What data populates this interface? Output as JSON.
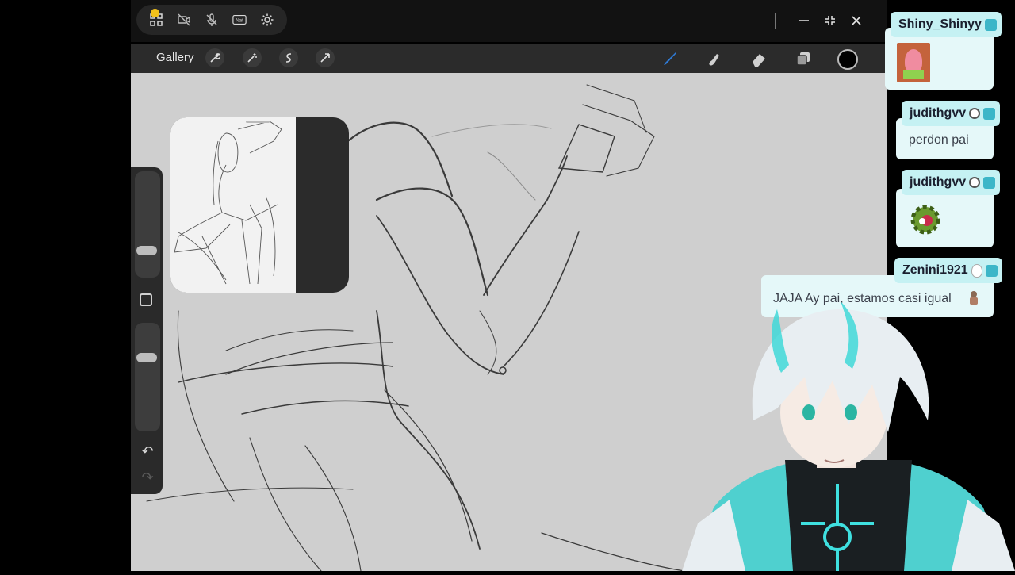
{
  "system_bar": {
    "icons": [
      "grid-icon",
      "camera-off-icon",
      "mic-off-icon",
      "nat-icon",
      "gear-icon"
    ],
    "nat_label": "Nat",
    "window_controls": [
      "minimize-icon",
      "collapse-icon",
      "close-icon"
    ],
    "recording_dot_color": "#f4c21b"
  },
  "toolbar": {
    "gallery_label": "Gallery",
    "left_tools": [
      "wrench-icon",
      "magic-wand-icon",
      "selection-icon",
      "transform-arrow-icon"
    ],
    "right_tools": [
      "brush-icon",
      "smudge-icon",
      "eraser-icon",
      "layers-icon"
    ],
    "active_tool": "brush-icon",
    "accent_color": "#2f7bd6",
    "current_color": "#000000"
  },
  "sidebar": {
    "size_slider_level": 0.25,
    "opacity_slider_level": 0.75,
    "controls": [
      "modify-square-icon",
      "undo-icon",
      "redo-icon"
    ]
  },
  "reference_window": {
    "content": "reference-sketch-image"
  },
  "chat": {
    "bubble_color": "#e5f8f9",
    "name_color": "#c5f1f3",
    "messages": [
      {
        "user": "Shiny_Shinyy",
        "text": "",
        "emote": "patrick-emote-icon"
      },
      {
        "user": "judithgvv",
        "text": "perdon pai",
        "emote": ""
      },
      {
        "user": "judithgvv",
        "text": "",
        "emote": "gear-emote-icon"
      },
      {
        "user": "Zenini1921",
        "text": "JAJA Ay pai, estamos casi igual",
        "emote": "small-figure-emote-icon"
      }
    ]
  },
  "avatar": {
    "description_icon": "vtuber-avatar-icon",
    "hair_color": "#e8eef2",
    "horn_color": "#3fd8d8",
    "jacket_color": "#4fd0cf"
  }
}
